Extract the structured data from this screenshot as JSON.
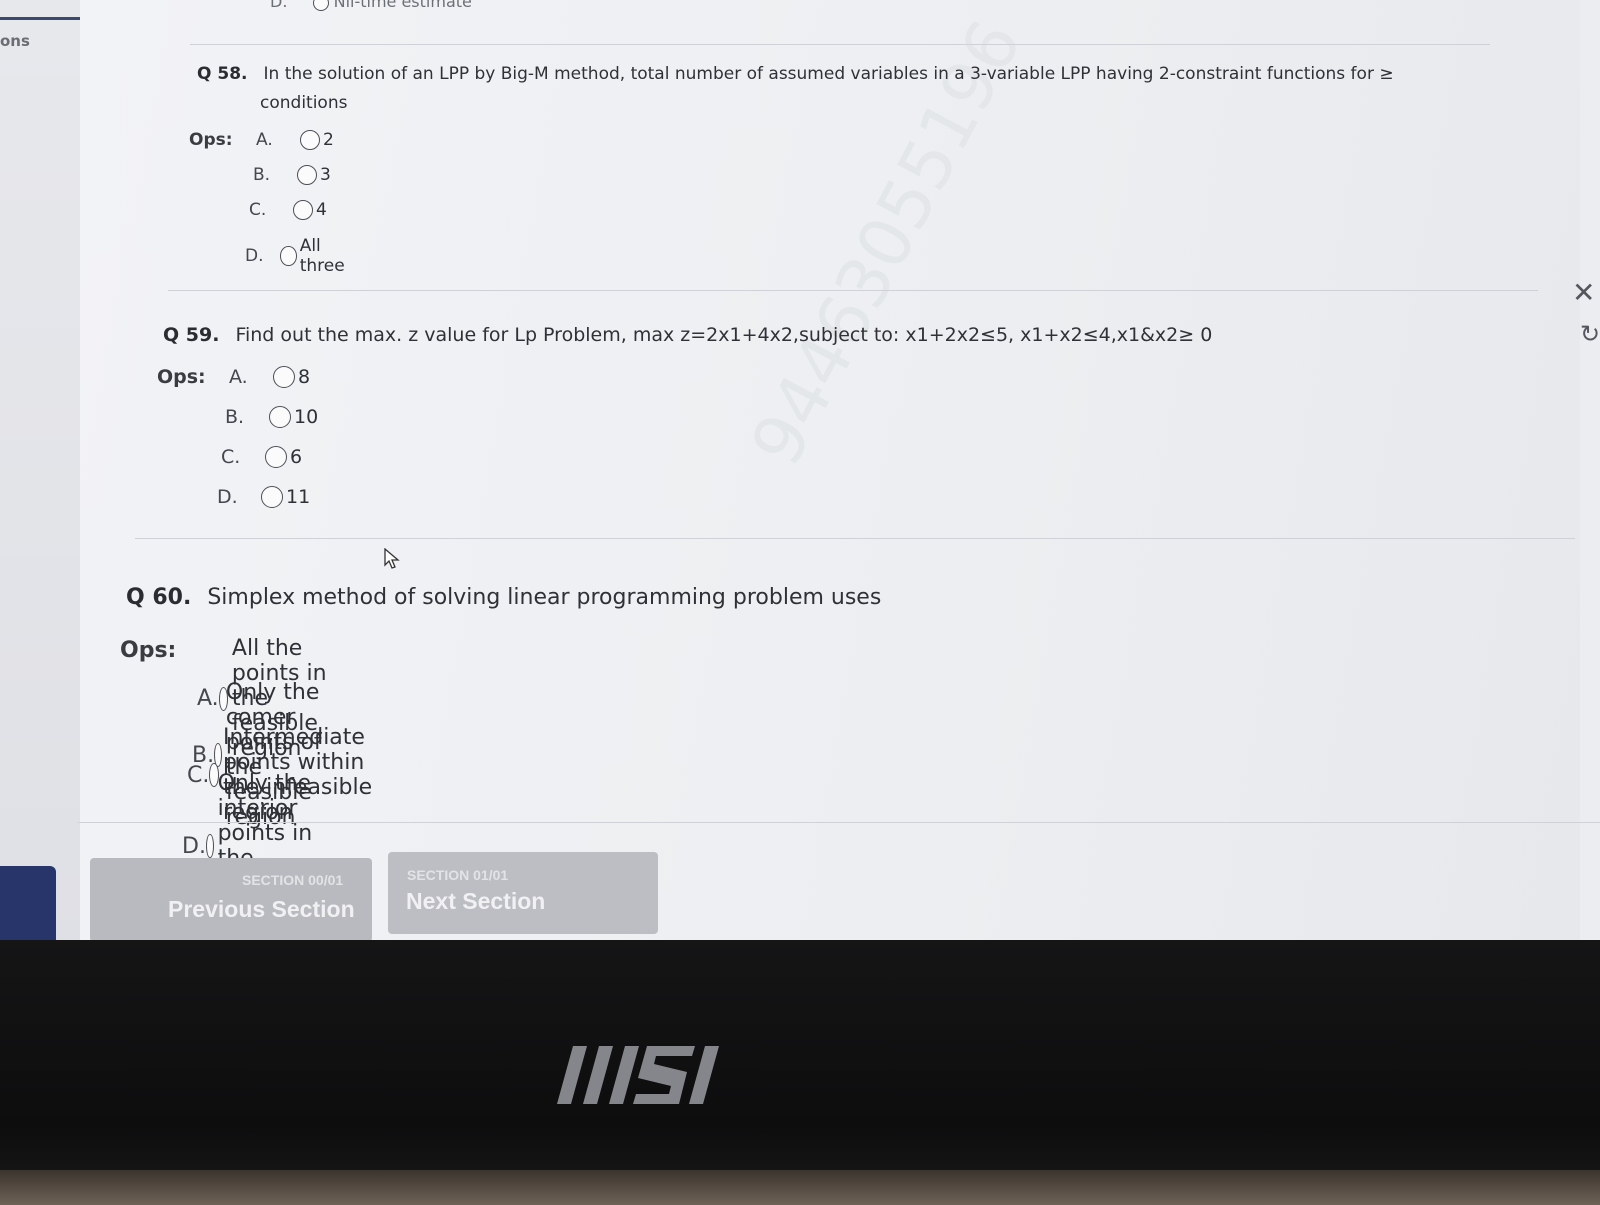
{
  "sidebar": {
    "label": "ons"
  },
  "top_option": {
    "letter": "D.",
    "text": "Nil-time estimate"
  },
  "questions": [
    {
      "number": "Q 58.",
      "text_line1": "In the solution of an LPP by Big-M method, total number of assumed variables in a 3-variable LPP having 2-constraint functions for ≥",
      "text_line2": "conditions",
      "ops_label": "Ops:",
      "options": [
        {
          "letter": "A.",
          "text": "2"
        },
        {
          "letter": "B.",
          "text": "3"
        },
        {
          "letter": "C.",
          "text": "4"
        },
        {
          "letter": "D.",
          "text": "All three"
        }
      ]
    },
    {
      "number": "Q 59.",
      "text_line1": "Find out the max. z value for Lp Problem, max z=2x1+4x2,subject to: x1+2x2≤5, x1+x2≤4,x1&x2≥ 0",
      "ops_label": "Ops:",
      "options": [
        {
          "letter": "A.",
          "text": "8"
        },
        {
          "letter": "B.",
          "text": "10"
        },
        {
          "letter": "C.",
          "text": "6"
        },
        {
          "letter": "D.",
          "text": "11"
        }
      ]
    },
    {
      "number": "Q 60.",
      "text_line1": "Simplex method of solving linear programming problem uses",
      "ops_label": "Ops:",
      "options": [
        {
          "letter": "A.",
          "text": "All the points in the feasible region"
        },
        {
          "letter": "B.",
          "text": "Only the comer points of the feasible region"
        },
        {
          "letter": "C.",
          "text": "Intermediate points within the infeasible region"
        },
        {
          "letter": "D.",
          "text": "Only the interior points in the feasible region"
        }
      ]
    }
  ],
  "watermark": "94463055196",
  "nav": {
    "prev_section_count": "SECTION 00/01",
    "prev_label": "Previous Section",
    "next_section_count": "SECTION 01/01",
    "next_label": "Next Section"
  },
  "edge_icons": {
    "close": "close-icon",
    "refresh": "refresh-icon"
  },
  "bezel": {
    "logo_text": "msi"
  },
  "colors": {
    "page_bg": "#ecedf1",
    "button_gray": "#b8babf",
    "nav_blue": "#27356a"
  }
}
